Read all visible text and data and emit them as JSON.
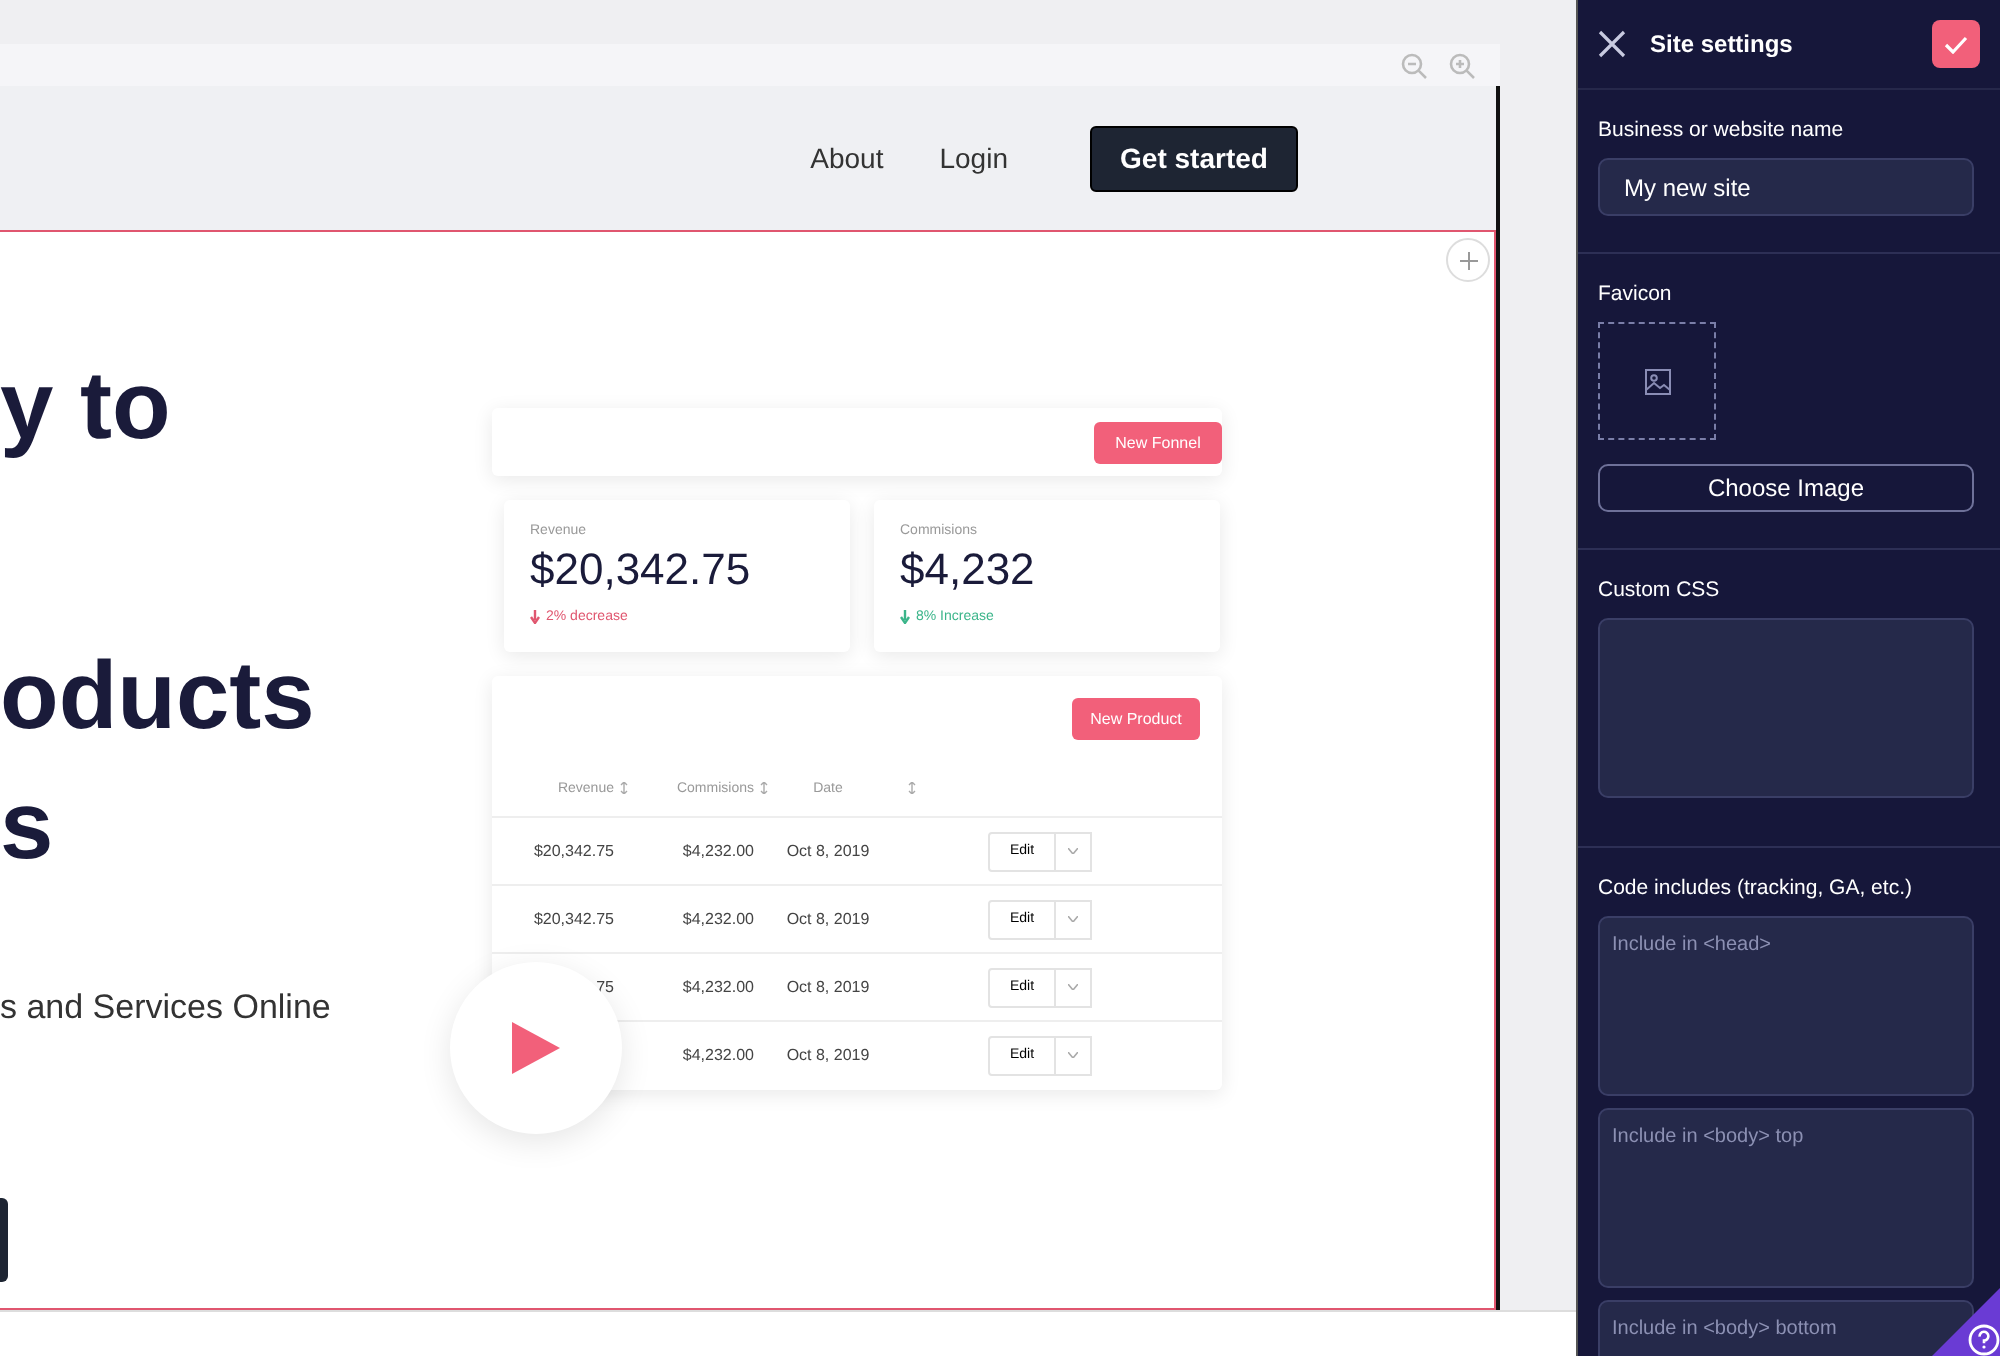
{
  "nav": {
    "links": [
      "About",
      "Login"
    ],
    "cta": "Get started"
  },
  "hero": {
    "headline_lines": [
      "y to",
      "oducts",
      "s"
    ],
    "subtitle": "s and Services Online"
  },
  "dashboard": {
    "top_button": "New Fonnel",
    "stats": [
      {
        "label": "Revenue",
        "value": "$20,342.75",
        "change": "2% decrease",
        "color": "#e0566f"
      },
      {
        "label": "Commisions",
        "value": "$4,232",
        "change": "8% Increase",
        "color": "#3bb58a"
      }
    ],
    "table": {
      "button": "New Product",
      "columns": [
        "Revenue",
        "Commisions",
        "Date"
      ],
      "rows": [
        {
          "revenue": "$20,342.75",
          "commissions": "$4,232.00",
          "date": "Oct 8, 2019",
          "action": "Edit"
        },
        {
          "revenue": "$20,342.75",
          "commissions": "$4,232.00",
          "date": "Oct 8, 2019",
          "action": "Edit"
        },
        {
          "revenue": "75",
          "commissions": "$4,232.00",
          "date": "Oct 8, 2019",
          "action": "Edit"
        },
        {
          "commissions": "$4,232.00",
          "date": "Oct 8, 2019",
          "action": "Edit"
        }
      ]
    }
  },
  "sidebar": {
    "title": "Site settings",
    "sections": [
      {
        "kind": "input",
        "label": "Business or website name",
        "value": "My new site"
      },
      {
        "kind": "image",
        "label": "Favicon",
        "button": "Choose Image"
      },
      {
        "kind": "code_box",
        "label": "Custom CSS"
      },
      {
        "kind": "textarea",
        "label": "Code includes (tracking, GA, etc.)",
        "boxes": [
          {
            "placeholder": "Include in <head>"
          },
          {
            "placeholder": "Include in <body> top"
          },
          {
            "placeholder": "Include in <body> bottom"
          }
        ]
      }
    ]
  }
}
